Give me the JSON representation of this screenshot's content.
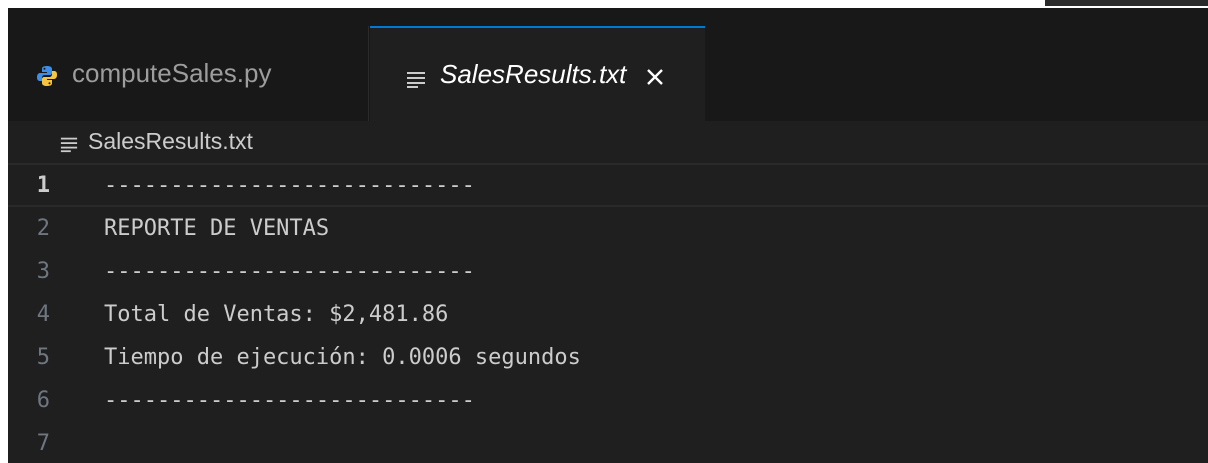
{
  "tabs": [
    {
      "label": "computeSales.py",
      "icon": "python-icon",
      "active": false
    },
    {
      "label": "SalesResults.txt",
      "icon": "text-file-icon",
      "active": true
    }
  ],
  "breadcrumb": {
    "file": "SalesResults.txt",
    "icon": "text-file-icon"
  },
  "editor": {
    "lines": [
      {
        "number": "1",
        "text": "----------------------------"
      },
      {
        "number": "2",
        "text": "REPORTE DE VENTAS"
      },
      {
        "number": "3",
        "text": "----------------------------"
      },
      {
        "number": "4",
        "text": "Total de Ventas: $2,481.86"
      },
      {
        "number": "5",
        "text": "Tiempo de ejecución: 0.0006 segundos"
      },
      {
        "number": "6",
        "text": "----------------------------"
      },
      {
        "number": "7",
        "text": ""
      }
    ],
    "current_line": 1
  },
  "colors": {
    "background": "#1f1f1f",
    "tabbar": "#181818",
    "accent": "#0078d4",
    "text": "#cccccc",
    "gutter": "#6e7681"
  }
}
